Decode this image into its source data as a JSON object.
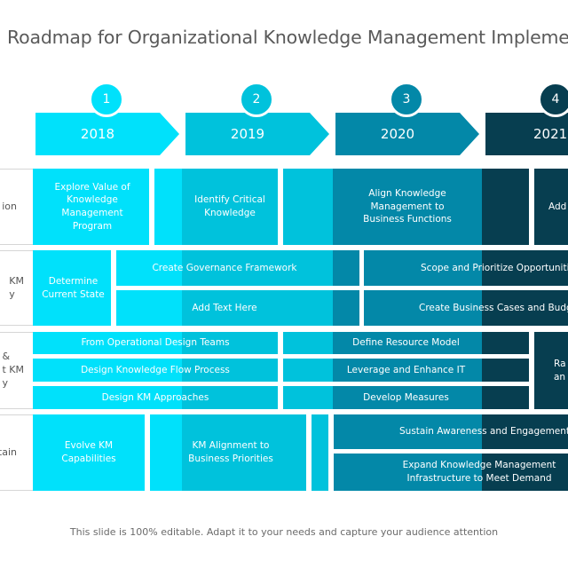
{
  "title": "Roadmap for Organizational Knowledge Management Implementation",
  "colors": {
    "y2018": "#00E1FB",
    "y2019": "#00C2DC",
    "y2020": "#0388A8",
    "y2021": "#073E50"
  },
  "timeline": [
    {
      "step": "1",
      "year": "2018"
    },
    {
      "step": "2",
      "year": "2019"
    },
    {
      "step": "3",
      "year": "2020"
    },
    {
      "step": "4",
      "year": "2021"
    }
  ],
  "rows": [
    {
      "label": "ion",
      "cells": [
        "Explore Value of Knowledge Management Program",
        "Identify Critical Knowledge",
        "Align Knowledge Management to Business Functions",
        "Add"
      ]
    },
    {
      "label": "KM\ny",
      "cells": [
        "Determine Current State",
        "Create Governance Framework",
        "Add Text Here",
        "Scope and Prioritize Opportunitie",
        "Create Business Cases and Budge"
      ]
    },
    {
      "label": "&\nt KM\ny",
      "cells": [
        "From Operational Design Teams",
        "Design Knowledge Flow Process",
        "Design KM Approaches",
        "Define Resource Model",
        "Leverage and Enhance IT",
        "Develop Measures",
        "Ra\nan"
      ]
    },
    {
      "label": "stain",
      "cells": [
        "Evolve KM Capabilities",
        "KM Alignment to Business Priorities",
        "Sustain Awareness and Engagement",
        "Expand Knowledge Management Infrastructure to Meet Demand"
      ]
    }
  ],
  "footer": "This slide is 100% editable. Adapt it to your needs and capture your audience attention"
}
